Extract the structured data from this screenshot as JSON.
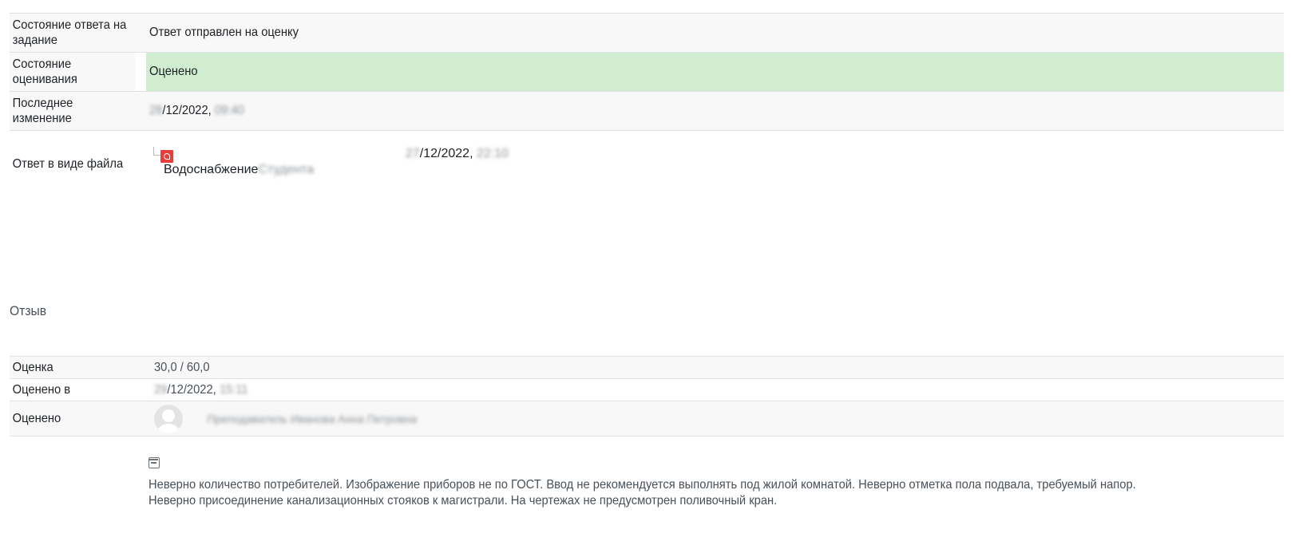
{
  "submission": {
    "rows": [
      {
        "label": "Состояние ответа на задание",
        "value": "Ответ отправлен на оценку"
      },
      {
        "label": "Состояние оценивания",
        "value": "Оценено"
      },
      {
        "label": "Последнее изменение",
        "value_prefix": "28",
        "value": "/12/2022,",
        "value_suffix": "09:40"
      }
    ],
    "file": {
      "label": "Ответ в виде файла",
      "icon": "pdf-icon",
      "name": "Водоснабжение",
      "name_suffix": "Студента",
      "date_prefix": "27",
      "date": "/12/2022,",
      "date_suffix": "22:10"
    }
  },
  "feedback": {
    "title": "Отзыв",
    "grade_label": "Оценка",
    "grade_value": "30,0 / 60,0",
    "graded_on_label": "Оценено в",
    "graded_on_prefix": "29",
    "graded_on_value": "/12/2022,",
    "graded_on_suffix": "15:11",
    "graded_by_label": "Оценено",
    "grader_name": "Преподаватель Иванова Анна Петровна",
    "comment": "Неверно количество потребителей. Изображение приборов не по ГОСТ. Ввод не рекомендуется выполнять под жилой комнатой. Неверно отметка пола подвала, требуемый напор. Неверно присоединение канализационных стояков к магистрали. На чертежах не предусмотрен поливочный кран."
  },
  "colors": {
    "graded_bg": "#d0eecf",
    "row_alt": "#f8f8f8",
    "pdf": "#e43f3a"
  }
}
